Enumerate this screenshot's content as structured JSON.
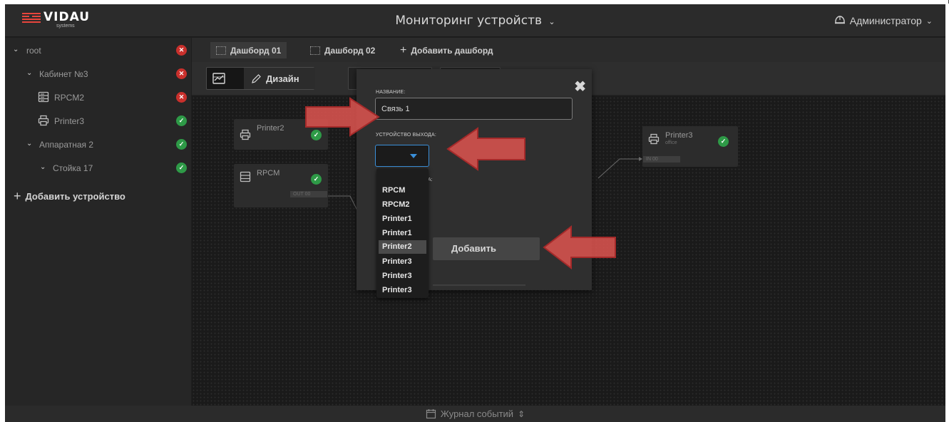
{
  "header": {
    "logo_text": "VIDAU",
    "logo_sub": "systems",
    "title": "Мониторинг устройств",
    "user": "Администратор"
  },
  "sidebar": {
    "items": [
      {
        "label": "root",
        "status": "error"
      },
      {
        "label": "Кабинет №3",
        "status": "error"
      },
      {
        "label": "RPCM2",
        "status": "error",
        "icon": "server-icon"
      },
      {
        "label": "Printer3",
        "status": "ok",
        "icon": "printer-icon"
      },
      {
        "label": "Аппаратная 2",
        "status": "ok"
      },
      {
        "label": "Стойка 17",
        "status": "ok"
      }
    ],
    "add_device": "Добавить устройство"
  },
  "tabs": {
    "items": [
      {
        "label": "Дашборд 01",
        "active": true
      },
      {
        "label": "Дашборд 02",
        "active": false
      }
    ],
    "add": "Добавить дашборд"
  },
  "toolbar": {
    "design_label": "Дизайн"
  },
  "canvas": {
    "nodes": [
      {
        "name": "Printer2",
        "icon": "printer-icon"
      },
      {
        "name": "RPCM",
        "icon": "server-icon",
        "port": "OUT 00"
      },
      {
        "name": "Printer3",
        "sub": "office",
        "icon": "printer-icon",
        "port": "IN 00"
      }
    ]
  },
  "modal": {
    "name_label": "НАЗВАНИЕ:",
    "name_value": "Связь 1",
    "output_label": "УСТРОЙСТВО ВЫХОДА:",
    "input_label_partial": "А:",
    "add_button": "Добавить",
    "dropdown_options": [
      "RPCM",
      "RPCM2",
      "Printer1",
      "Printer1",
      "Printer2",
      "Printer3",
      "Printer3",
      "Printer3"
    ],
    "highlighted_option": "Printer2"
  },
  "footer": {
    "label": "Журнал событий"
  },
  "colors": {
    "accent": "#3a8fd9",
    "error": "#c9302c",
    "ok": "#2e9a47",
    "arrow": "#d9534f"
  }
}
